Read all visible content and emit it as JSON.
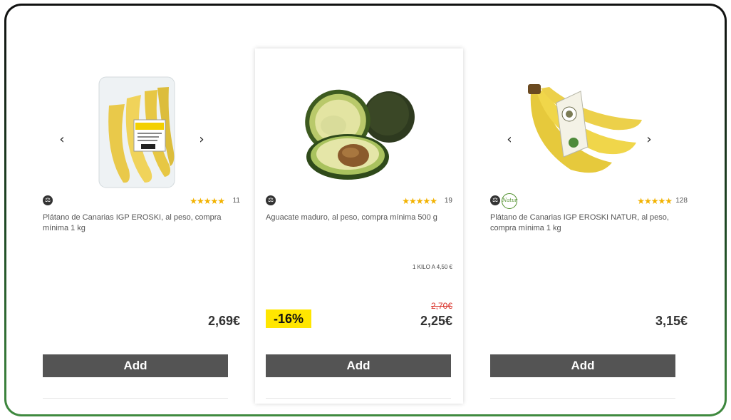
{
  "products": [
    {
      "title": "Plátano de Canarias IGP EROSKI, al peso, compra mínima 1 kg",
      "rating_count": "11",
      "stars": "★★★★★",
      "price": "2,69€",
      "add_label": "Add",
      "has_carousel": true,
      "image": "banana-bag-image"
    },
    {
      "title": "Aguacate maduro, al peso, compra mínima 500 g",
      "rating_count": "19",
      "stars": "★★★★★",
      "unit_price": "1 KILO A 4,50 €",
      "discount": "-16%",
      "old_price": "2,70€",
      "price": "2,25€",
      "add_label": "Add",
      "has_carousel": false,
      "image": "avocado-image"
    },
    {
      "title": "Plátano de Canarias IGP EROSKI NATUR, al peso, compra mínima 1 kg",
      "rating_count": "128",
      "stars": "★★★★★",
      "price": "3,15€",
      "add_label": "Add",
      "has_carousel": true,
      "badge": "Natur",
      "image": "banana-bunch-image"
    }
  ],
  "icons": {
    "weigh": "scale-icon",
    "prev": "chevron-left-icon",
    "next": "chevron-right-icon"
  },
  "colors": {
    "button": "#545454",
    "discount_bg": "#ffe600",
    "old_price": "#d9322a",
    "star": "#f2b200",
    "natur": "#4f8f2a"
  }
}
